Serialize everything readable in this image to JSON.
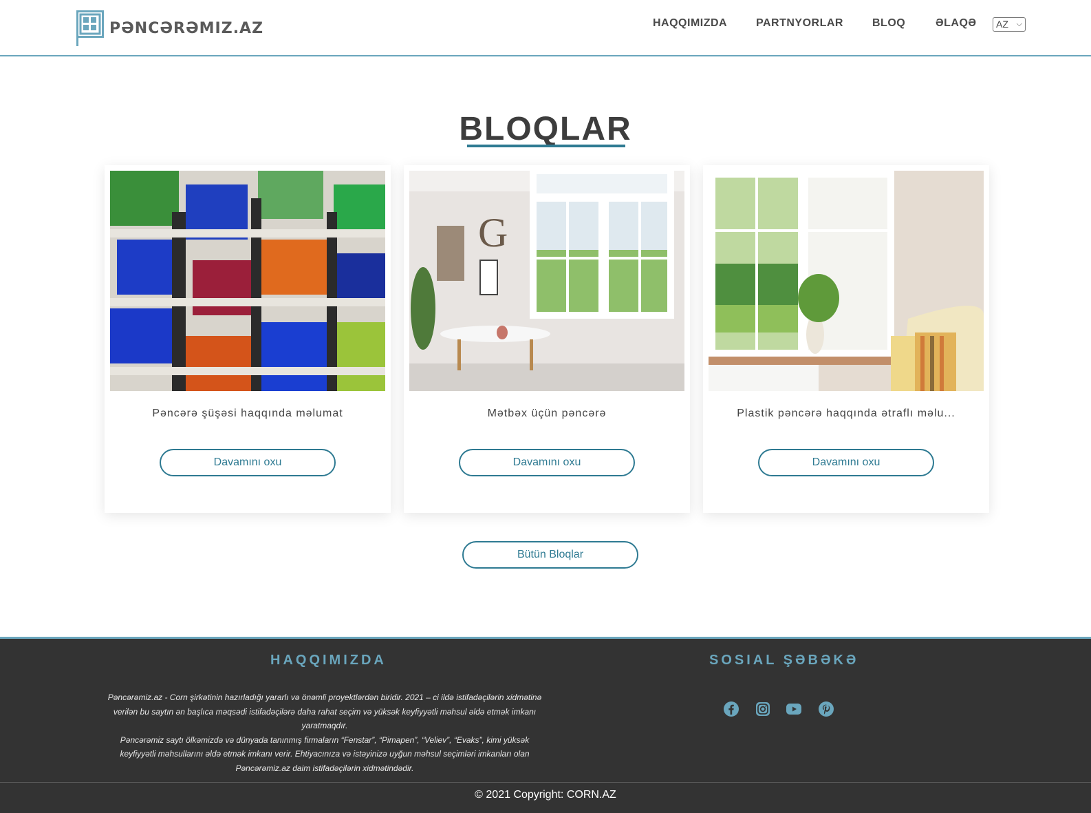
{
  "brand": {
    "name": "PƏNCƏRƏMIZ.AZ"
  },
  "nav": {
    "items": [
      {
        "label": "HAQQIMIZDA"
      },
      {
        "label": "PARTNYORLAR"
      },
      {
        "label": "BLOQ"
      },
      {
        "label": "ƏLAQƏ"
      }
    ],
    "language": "AZ"
  },
  "main": {
    "title": "BLOQLAR",
    "cards": [
      {
        "title": "Pəncərə şüşəsi haqqında məlumat",
        "button": "Davamını oxu"
      },
      {
        "title": "Mətbəx üçün pəncərə",
        "button": "Davamını oxu"
      },
      {
        "title": "Plastik pəncərə haqqında ətraflı məlu...",
        "button": "Davamını oxu"
      }
    ],
    "all_button": "Bütün Bloqlar"
  },
  "footer": {
    "about_heading": "HAQQIMIZDA",
    "about_p1": "Pəncərəmiz.az - Corn şirkətinin hazırladığı yararlı və önəmli proyektlərdən biridir. 2021 – ci ildə istifadəçilərin xidmətinə verilən bu saytın ən başlıca məqsədi istifadəçilərə daha rahat seçim və yüksək keyfiyyətli məhsul əldə etmək imkanı yaratmaqdır.",
    "about_p2": "Pəncərəmiz saytı ölkəmizdə və dünyada tanınmış firmaların “Fenstar”, “Pimapen”, “Veliev”, “Evaks”,  kimi yüksək keyfiyyətli məhsullarını əldə etmək imkanı verir. Ehtiyacınıza və istəyinizə uyğun məhsul seçimləri imkanları olan Pəncərəmiz.az daim istifadəçilərin xidmətindədir.",
    "social_heading": "SOSIAL ŞƏBƏKƏ",
    "social_icons": [
      "facebook-icon",
      "instagram-icon",
      "youtube-icon",
      "pinterest-icon"
    ],
    "copyright": "© 2021 Copyright: CORN.AZ"
  },
  "colors": {
    "accent": "#2e7a92",
    "light_accent": "#6aa6bd",
    "footer_bg": "#333333"
  }
}
